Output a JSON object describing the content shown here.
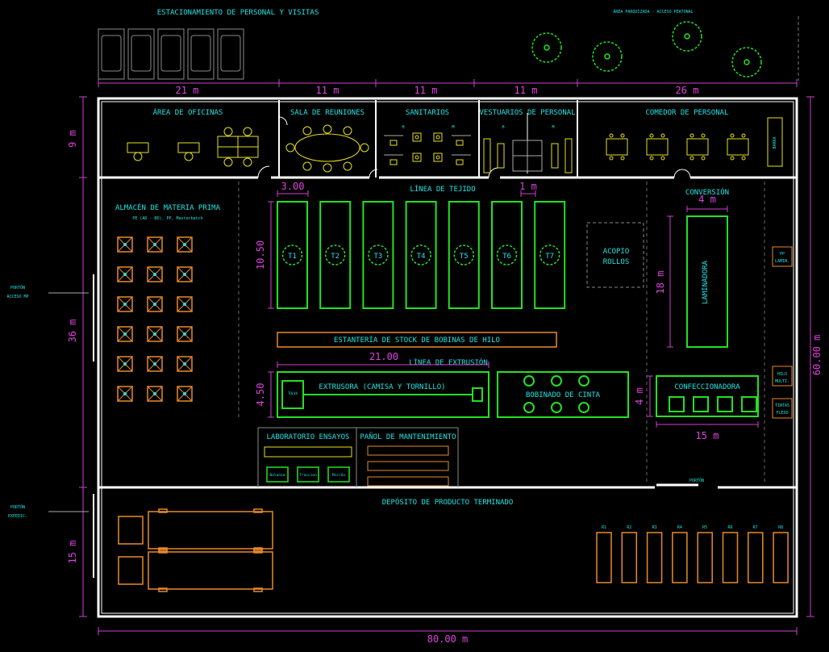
{
  "labels": {
    "parking": "ESTACIONAMIENTO DE PERSONAL Y VISITAS",
    "green_area": "ÁREA PARQUIZADA - ACCESO PEATONAL",
    "offices": "ÁREA DE OFICINAS",
    "meeting": "SALA DE REUNIONES",
    "toilets": "SANITARIOS",
    "locker": "VESTUARIOS DE PERSONAL",
    "dining": "COMEDOR DE PERSONAL",
    "bar": "BARRA",
    "raw_store": "ALMACÉN DE MATERIA PRIMA",
    "raw_sub": "PE (AD - BD), PP, Masterbatch",
    "gate_mp_1": "PORTÓN",
    "gate_mp_2": "ACCESO MP",
    "gate_exp_1": "PORTÓN",
    "gate_exp_2": "EXPEDIC.",
    "weaving": "LÍNEA DE TEJIDO",
    "rolls_1": "ACOPIO",
    "rolls_2": "ROLLOS",
    "conversion": "CONVERSIÓN",
    "laminator": "LAMINADORA",
    "pp_lamin_1": "PP",
    "pp_lamin_2": "LAMIN.",
    "thread_shelf": "ESTANTERÍA DE STOCK DE BOBINAS DE HILO",
    "extrusion_line": "LÍNEA DE EXTRUSIÓN",
    "extruder": "EXTRUSORA (CAMISA Y TORNILLO)",
    "hopper": "TOLVA",
    "tape_winding": "BOBINADO DE CINTA",
    "confection": "CONFECCIONADORA",
    "multi_1": "HILO",
    "multi_2": "MULTI.",
    "flexo_1": "TINTAS",
    "flexo_2": "FLEXO",
    "lab": "LABORATORIO ENSAYOS",
    "maintenance": "PAÑOL DE MANTENIMIENTO",
    "lab_eq": [
      "Balanza",
      "Traccion",
      "Micrón"
    ],
    "gate_inner": "PORTÓN",
    "finished": "DEPÓSITO DE PRODUCTO TERMINADO",
    "wc_h": "H",
    "wc_m": "M"
  },
  "looms": [
    "T1",
    "T2",
    "T3",
    "T4",
    "T5",
    "T6",
    "T7"
  ],
  "racks": [
    "R1",
    "R2",
    "R3",
    "R4",
    "R5",
    "R6",
    "R7",
    "R8"
  ],
  "dims": {
    "d21": "21 m",
    "d11a": "11 m",
    "d11b": "11 m",
    "d11c": "11 m",
    "d26": "26 m",
    "d9": "9 m",
    "d36": "36 m",
    "d15v": "15 m",
    "d80": "80.00 m",
    "d60": "60.00 m",
    "d300": "3.00",
    "d1": "1 m",
    "d1050": "10.50",
    "d4a": "4 m",
    "d18": "18 m",
    "d2100": "21.00",
    "d450": "4.50",
    "d4b": "4 m",
    "d15h": "15 m"
  },
  "colors": {
    "label": "#1fe4e4",
    "dimension": "#e040e0",
    "machine": "#22e122",
    "storage": "#e88a2a",
    "furniture": "#e6e020",
    "wall": "#ffffff",
    "background": "#000000"
  }
}
